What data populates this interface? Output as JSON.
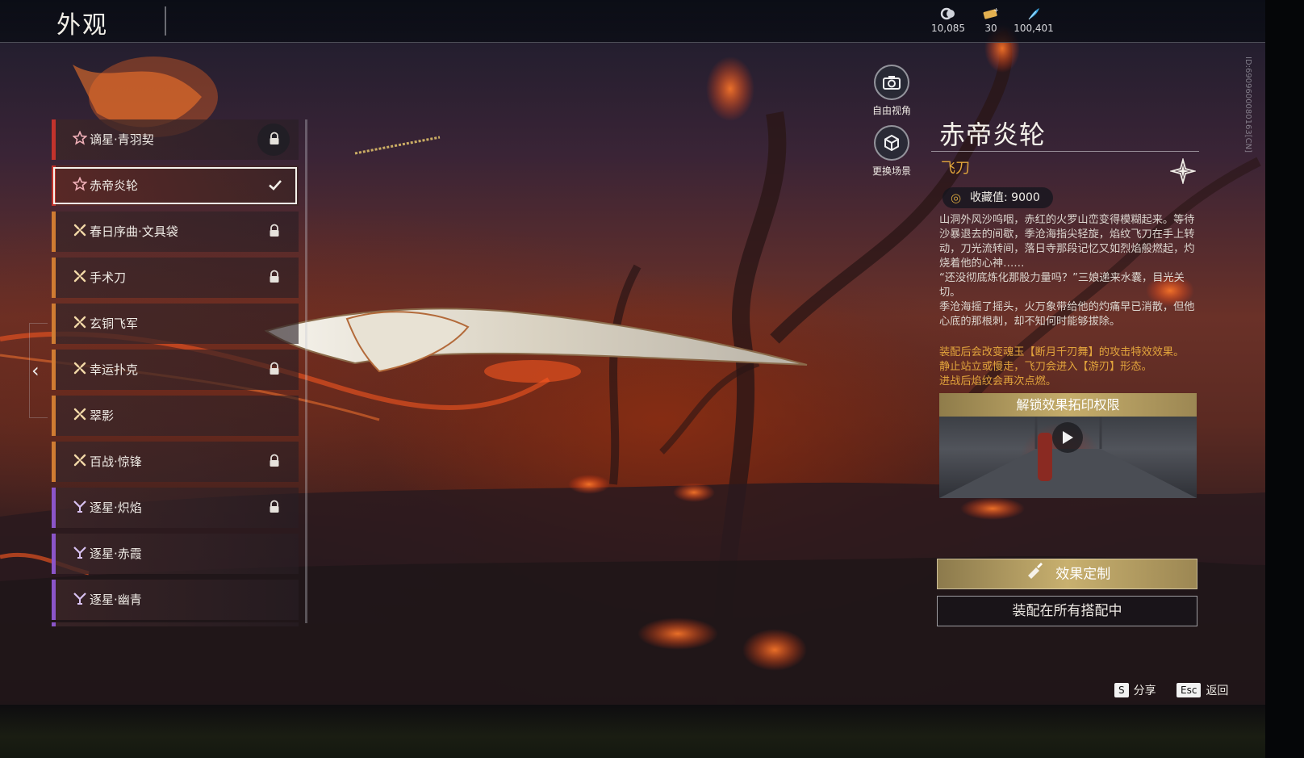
{
  "header": {
    "title": "外观",
    "currencies": [
      {
        "icon": "soul-jade-icon",
        "value": "10,085"
      },
      {
        "icon": "ticket-icon",
        "value": "30"
      },
      {
        "icon": "feather-icon",
        "value": "100,401"
      }
    ],
    "side_id": "ID:6909600080163[CN]"
  },
  "list": {
    "items": [
      {
        "name": "谪星·青羽契",
        "rank_icon": "star-outline-icon",
        "rarity": "red",
        "state": "locked"
      },
      {
        "name": "赤帝炎轮",
        "rank_icon": "star-outline-icon",
        "rarity": "red",
        "state": "equipped"
      },
      {
        "name": "春日序曲·文具袋",
        "rank_icon": "cross-dots-icon",
        "rarity": "orange",
        "state": "locked"
      },
      {
        "name": "手术刀",
        "rank_icon": "cross-dots-icon",
        "rarity": "orange",
        "state": "locked"
      },
      {
        "name": "玄铜飞军",
        "rank_icon": "cross-dots-icon",
        "rarity": "orange",
        "state": "none"
      },
      {
        "name": "幸运扑克",
        "rank_icon": "cross-dots-icon",
        "rarity": "orange",
        "state": "locked"
      },
      {
        "name": "翠影",
        "rank_icon": "cross-dots-icon",
        "rarity": "orange",
        "state": "none"
      },
      {
        "name": "百战·惊锋",
        "rank_icon": "cross-dots-icon",
        "rarity": "orange",
        "state": "locked"
      },
      {
        "name": "逐星·炽焰",
        "rank_icon": "chalice-icon",
        "rarity": "purple",
        "state": "locked"
      },
      {
        "name": "逐星·赤霞",
        "rank_icon": "chalice-icon",
        "rarity": "purple",
        "state": "none"
      },
      {
        "name": "逐星·幽青",
        "rank_icon": "chalice-icon",
        "rarity": "purple",
        "state": "none"
      }
    ]
  },
  "tools": {
    "free_view": "自由视角",
    "change_scene": "更换场景"
  },
  "detail": {
    "name": "赤帝炎轮",
    "type": "飞刀",
    "collection_label": "收藏值: 9000",
    "description": [
      "山洞外风沙呜咽，赤红的火罗山峦变得模糊起来。等待沙暴退去的间歇，季沧海指尖轻旋，焰纹飞刀在手上转动，刀光流转间，落日寺那段记忆又如烈焰般燃起，灼烧着他的心神……",
      "“还没彻底炼化那股力量吗？”三娘递来水囊，目光关切。",
      "季沧海摇了摇头，火万象带给他的灼痛早已消散，但他心底的那根刺，却不知何时能够拔除。"
    ],
    "effect_text": [
      "装配后会改变魂玉【断月千刃舞】的攻击特效效果。",
      "静止站立或慢走，飞刀会进入【游刃】形态。",
      "进战后焰纹会再次点燃。"
    ],
    "preview_title": "解锁效果拓印权限"
  },
  "actions": {
    "customize_label": "效果定制",
    "equip_all_label": "装配在所有搭配中"
  },
  "hints": {
    "share_key": "S",
    "share_label": "分享",
    "back_key": "Esc",
    "back_label": "返回"
  },
  "colors": {
    "gold": "#c8b06f",
    "type_orange": "#e1a53b",
    "rarity_red": "#c2332c",
    "rarity_orange": "#d07c32",
    "rarity_purple": "#8b55c9"
  }
}
